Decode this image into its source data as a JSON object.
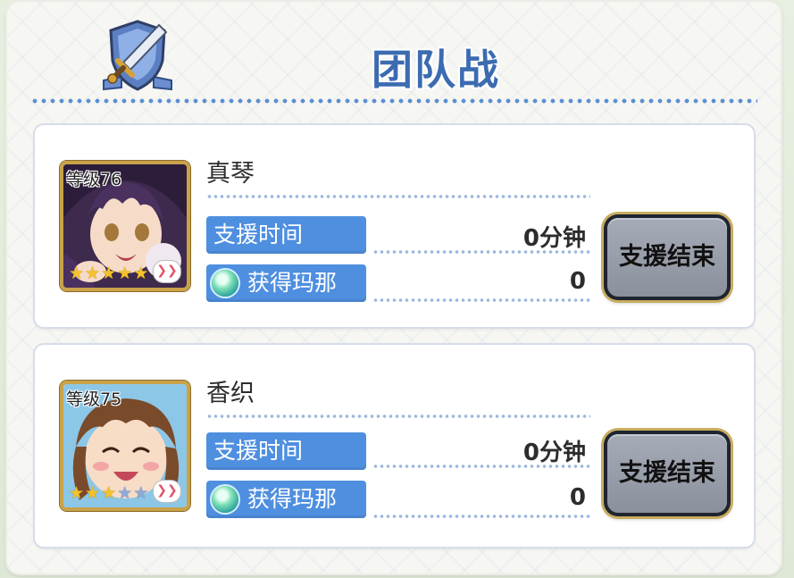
{
  "header": {
    "title": "团队战",
    "emblem_icon": "shield-sword-icon"
  },
  "colors": {
    "title": "#3c6bb0",
    "label_bg": "#4f8fe0",
    "button_bg": "#8a909c",
    "button_border": "#c8ad60"
  },
  "supporters": [
    {
      "level": "等级76",
      "name": "真琴",
      "support_time_label": "支援时间",
      "support_time_value": "0分钟",
      "mana_label": "获得玛那",
      "mana_value": "0",
      "stars": 5,
      "end_button": "支援结束"
    },
    {
      "level": "等级75",
      "name": "香织",
      "support_time_label": "支援时间",
      "support_time_value": "0分钟",
      "mana_label": "获得玛那",
      "mana_value": "0",
      "stars": 3,
      "end_button": "支援结束"
    }
  ]
}
